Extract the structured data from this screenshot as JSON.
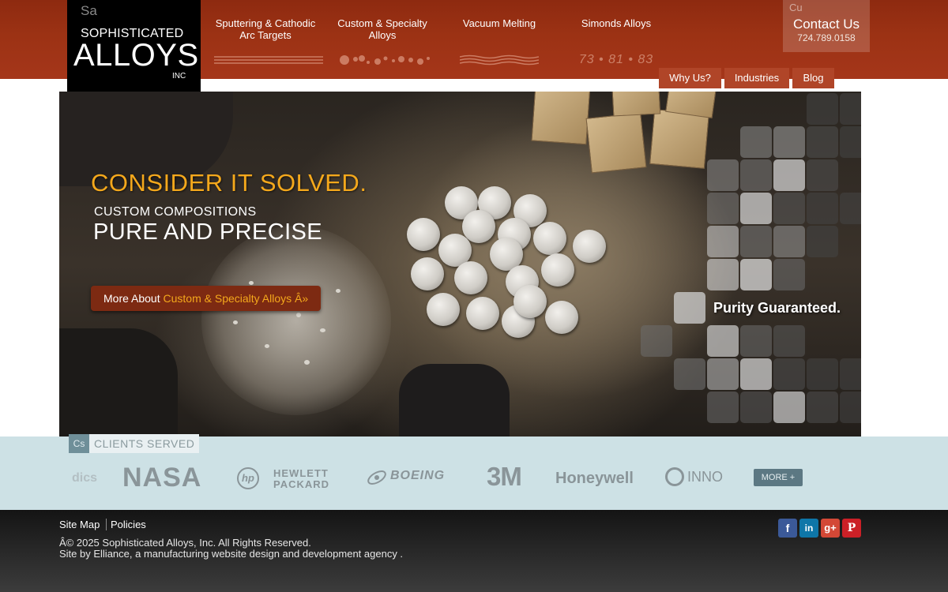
{
  "header": {
    "logo": {
      "symbol": "Sa",
      "line1": "SOPHISTICATED",
      "line2": "ALLOYS",
      "line3": "INC"
    },
    "nav": [
      {
        "line1": "Sputtering & Cathodic",
        "line2": "Arc Targets"
      },
      {
        "line1": "Custom & Specialty",
        "line2": "Alloys"
      },
      {
        "line1": "Vacuum Melting",
        "line2": ""
      },
      {
        "line1": "Simonds Alloys",
        "line2": ""
      }
    ],
    "nav_years": "73 • 81 • 83",
    "contact": {
      "symbol": "Cu",
      "title": "Contact Us",
      "phone": "724.789.0158"
    },
    "subnav": [
      "Why Us?",
      "Industries",
      "Blog"
    ]
  },
  "hero": {
    "headline": "CONSIDER IT SOLVED.",
    "subline1": "CUSTOM COMPOSITIONS",
    "subline2": "PURE AND PRECISE",
    "cta_prefix": "More About ",
    "cta_link": "Custom & Specialty Alloys Â»",
    "purity": "Purity Guaranteed."
  },
  "clients": {
    "symbol": "Cs",
    "label": "CLIENTS SERVED",
    "logos": [
      "dics",
      "NASA",
      "HEWLETT PACKARD",
      "BOEING",
      "3M",
      "Honeywell",
      "INNO"
    ],
    "hp_mark": "hp",
    "more": "MORE +"
  },
  "footer": {
    "links": [
      "Site Map",
      "Policies"
    ],
    "copyright": "Â© 2025 Sophisticated Alloys, Inc. All Rights Reserved.",
    "credit": "Site by Elliance, a manufacturing website design and development agency .",
    "social": {
      "facebook": "f",
      "linkedin": "in",
      "googleplus": "g+",
      "pinterest": "P"
    }
  },
  "colors": {
    "header_red": "#9c3214",
    "subnav_red": "#b04528",
    "accent_orange": "#f4a81c",
    "clients_bg": "#cde1e5",
    "more_button": "#5c7883",
    "footer_dark": "#222222"
  }
}
